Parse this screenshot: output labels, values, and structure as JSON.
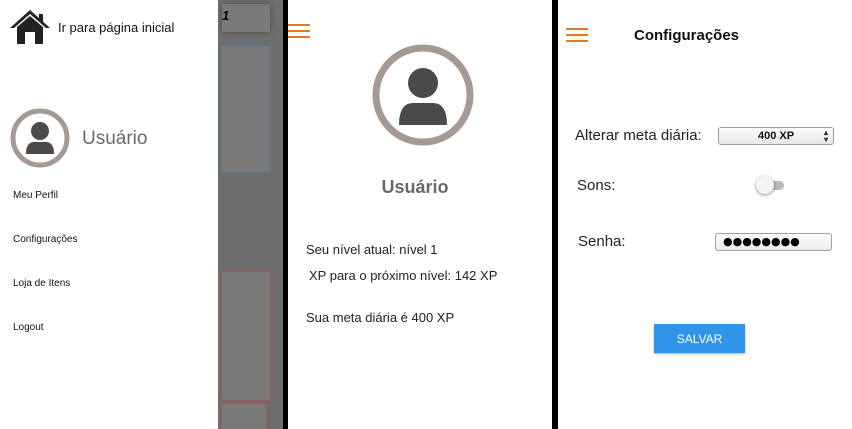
{
  "drawer": {
    "home_label": "Ir para página inicial",
    "user_name": "Usuário",
    "menu": [
      {
        "label": "Meu Perfil"
      },
      {
        "label": "Configurações"
      },
      {
        "label": "Loja de Itens"
      },
      {
        "label": "Logout"
      }
    ],
    "overlay_number": "1"
  },
  "profile": {
    "user_name": "Usuário",
    "level_text": "Seu nível atual: nível 1",
    "xp_text": "XP para o próximo nível: 142 XP",
    "goal_text": "Sua meta diária é 400 XP"
  },
  "settings": {
    "title": "Configurações",
    "goal_label": "Alterar meta diária:",
    "goal_value": "400 XP",
    "sound_label": "Sons:",
    "sound_enabled": false,
    "password_label": "Senha:",
    "password_masked": "●●●●●●●●",
    "save_label": "SALVAR"
  },
  "colors": {
    "accent_orange": "#e07a28",
    "button_blue": "#2f95e8",
    "avatar_ring": "#a59a93",
    "avatar_figure": "#4a4a4a"
  },
  "icons": [
    "home-icon",
    "menu-icon",
    "avatar-icon",
    "select-arrows-icon"
  ]
}
